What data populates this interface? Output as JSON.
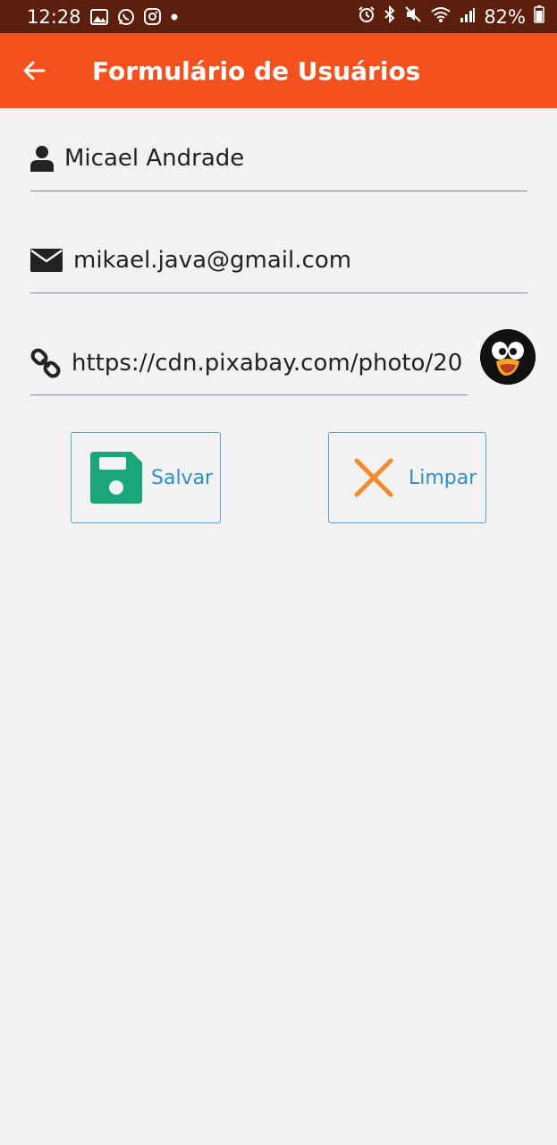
{
  "status_bar": {
    "time": "12:28",
    "battery_percent": "82%",
    "left_icons": [
      "gallery-icon",
      "whatsapp-icon",
      "instagram-icon",
      "dot-icon"
    ],
    "right_icons": [
      "alarm-icon",
      "bluetooth-icon",
      "mute-icon",
      "wifi-icon",
      "signal-icon",
      "battery-icon"
    ]
  },
  "app_bar": {
    "title": "Formulário de Usuários",
    "back_icon": "arrow-left-icon",
    "color": "#f4511e"
  },
  "form": {
    "name": {
      "icon": "user-icon",
      "value": "Micael Andrade"
    },
    "email": {
      "icon": "envelope-icon",
      "value": "mikael.java@gmail.com"
    },
    "avatar_url": {
      "icon": "link-icon",
      "value": "https://cdn.pixabay.com/photo/20"
    },
    "avatar_preview": "penguin-avatar"
  },
  "buttons": {
    "save": {
      "label": "Salvar",
      "icon": "floppy-disk-icon",
      "icon_color": "#1aa67a"
    },
    "clear": {
      "label": "Limpar",
      "icon": "close-icon",
      "icon_color": "#f28a2e"
    }
  }
}
